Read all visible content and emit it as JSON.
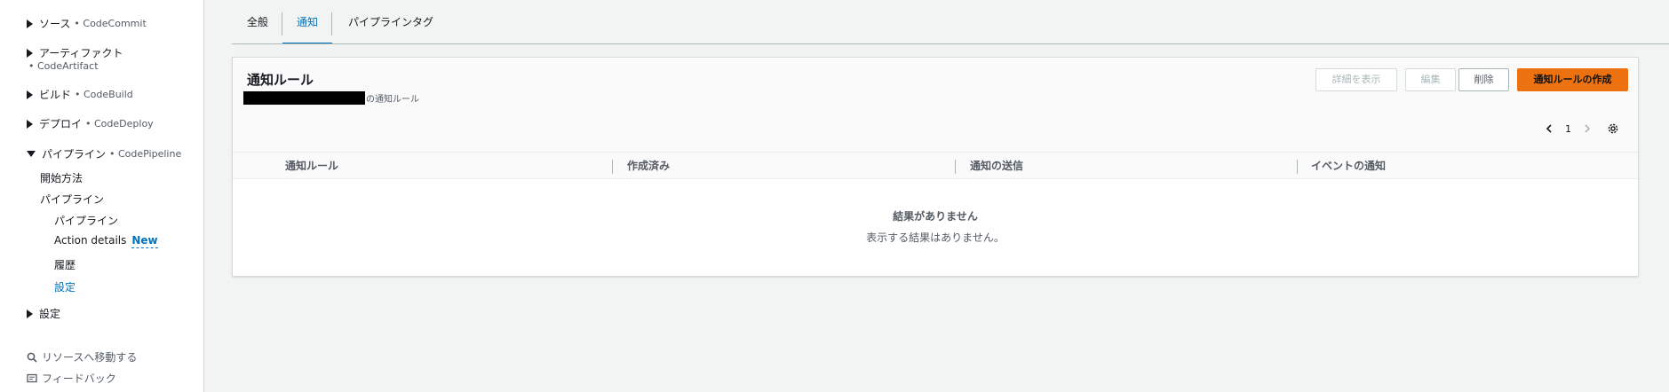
{
  "sidebar": {
    "groups": [
      {
        "label": "ソース",
        "sub": "• CodeCommit",
        "expanded": false
      },
      {
        "label": "アーティファクト",
        "sub": "• CodeArtifact",
        "expanded": false
      },
      {
        "label": "ビルド",
        "sub": "• CodeBuild",
        "expanded": false
      },
      {
        "label": "デプロイ",
        "sub": "• CodeDeploy",
        "expanded": false
      },
      {
        "label": "パイプライン",
        "sub": "• CodePipeline",
        "expanded": true
      },
      {
        "label": "設定",
        "sub": "",
        "expanded": false
      }
    ],
    "pipeline_items": {
      "getting_started": "開始方法",
      "pipelines": "パイプライン",
      "pipeline": "パイプライン",
      "action_details": "Action details",
      "action_details_badge": "New",
      "history": "履歴",
      "settings": "設定"
    },
    "utilities": {
      "go_to_resource": "リソースへ移動する",
      "feedback": "フィードバック"
    }
  },
  "tabs": [
    {
      "label": "全般",
      "active": false
    },
    {
      "label": "通知",
      "active": true
    },
    {
      "label": "パイプラインタグ",
      "active": false
    }
  ],
  "panel": {
    "title": "通知ルール",
    "description_suffix": "の通知ルール",
    "buttons": {
      "view_details": "詳細を表示",
      "edit": "編集",
      "delete": "削除",
      "create": "通知ルールの作成"
    },
    "pagination": {
      "page": "1"
    },
    "columns": [
      "通知ルール",
      "作成済み",
      "通知の送信",
      "イベントの通知"
    ],
    "empty": {
      "title": "結果がありません",
      "message": "表示する結果はありません。"
    }
  },
  "colors": {
    "accent": "#0073bb",
    "primary_button": "#ec7211"
  }
}
